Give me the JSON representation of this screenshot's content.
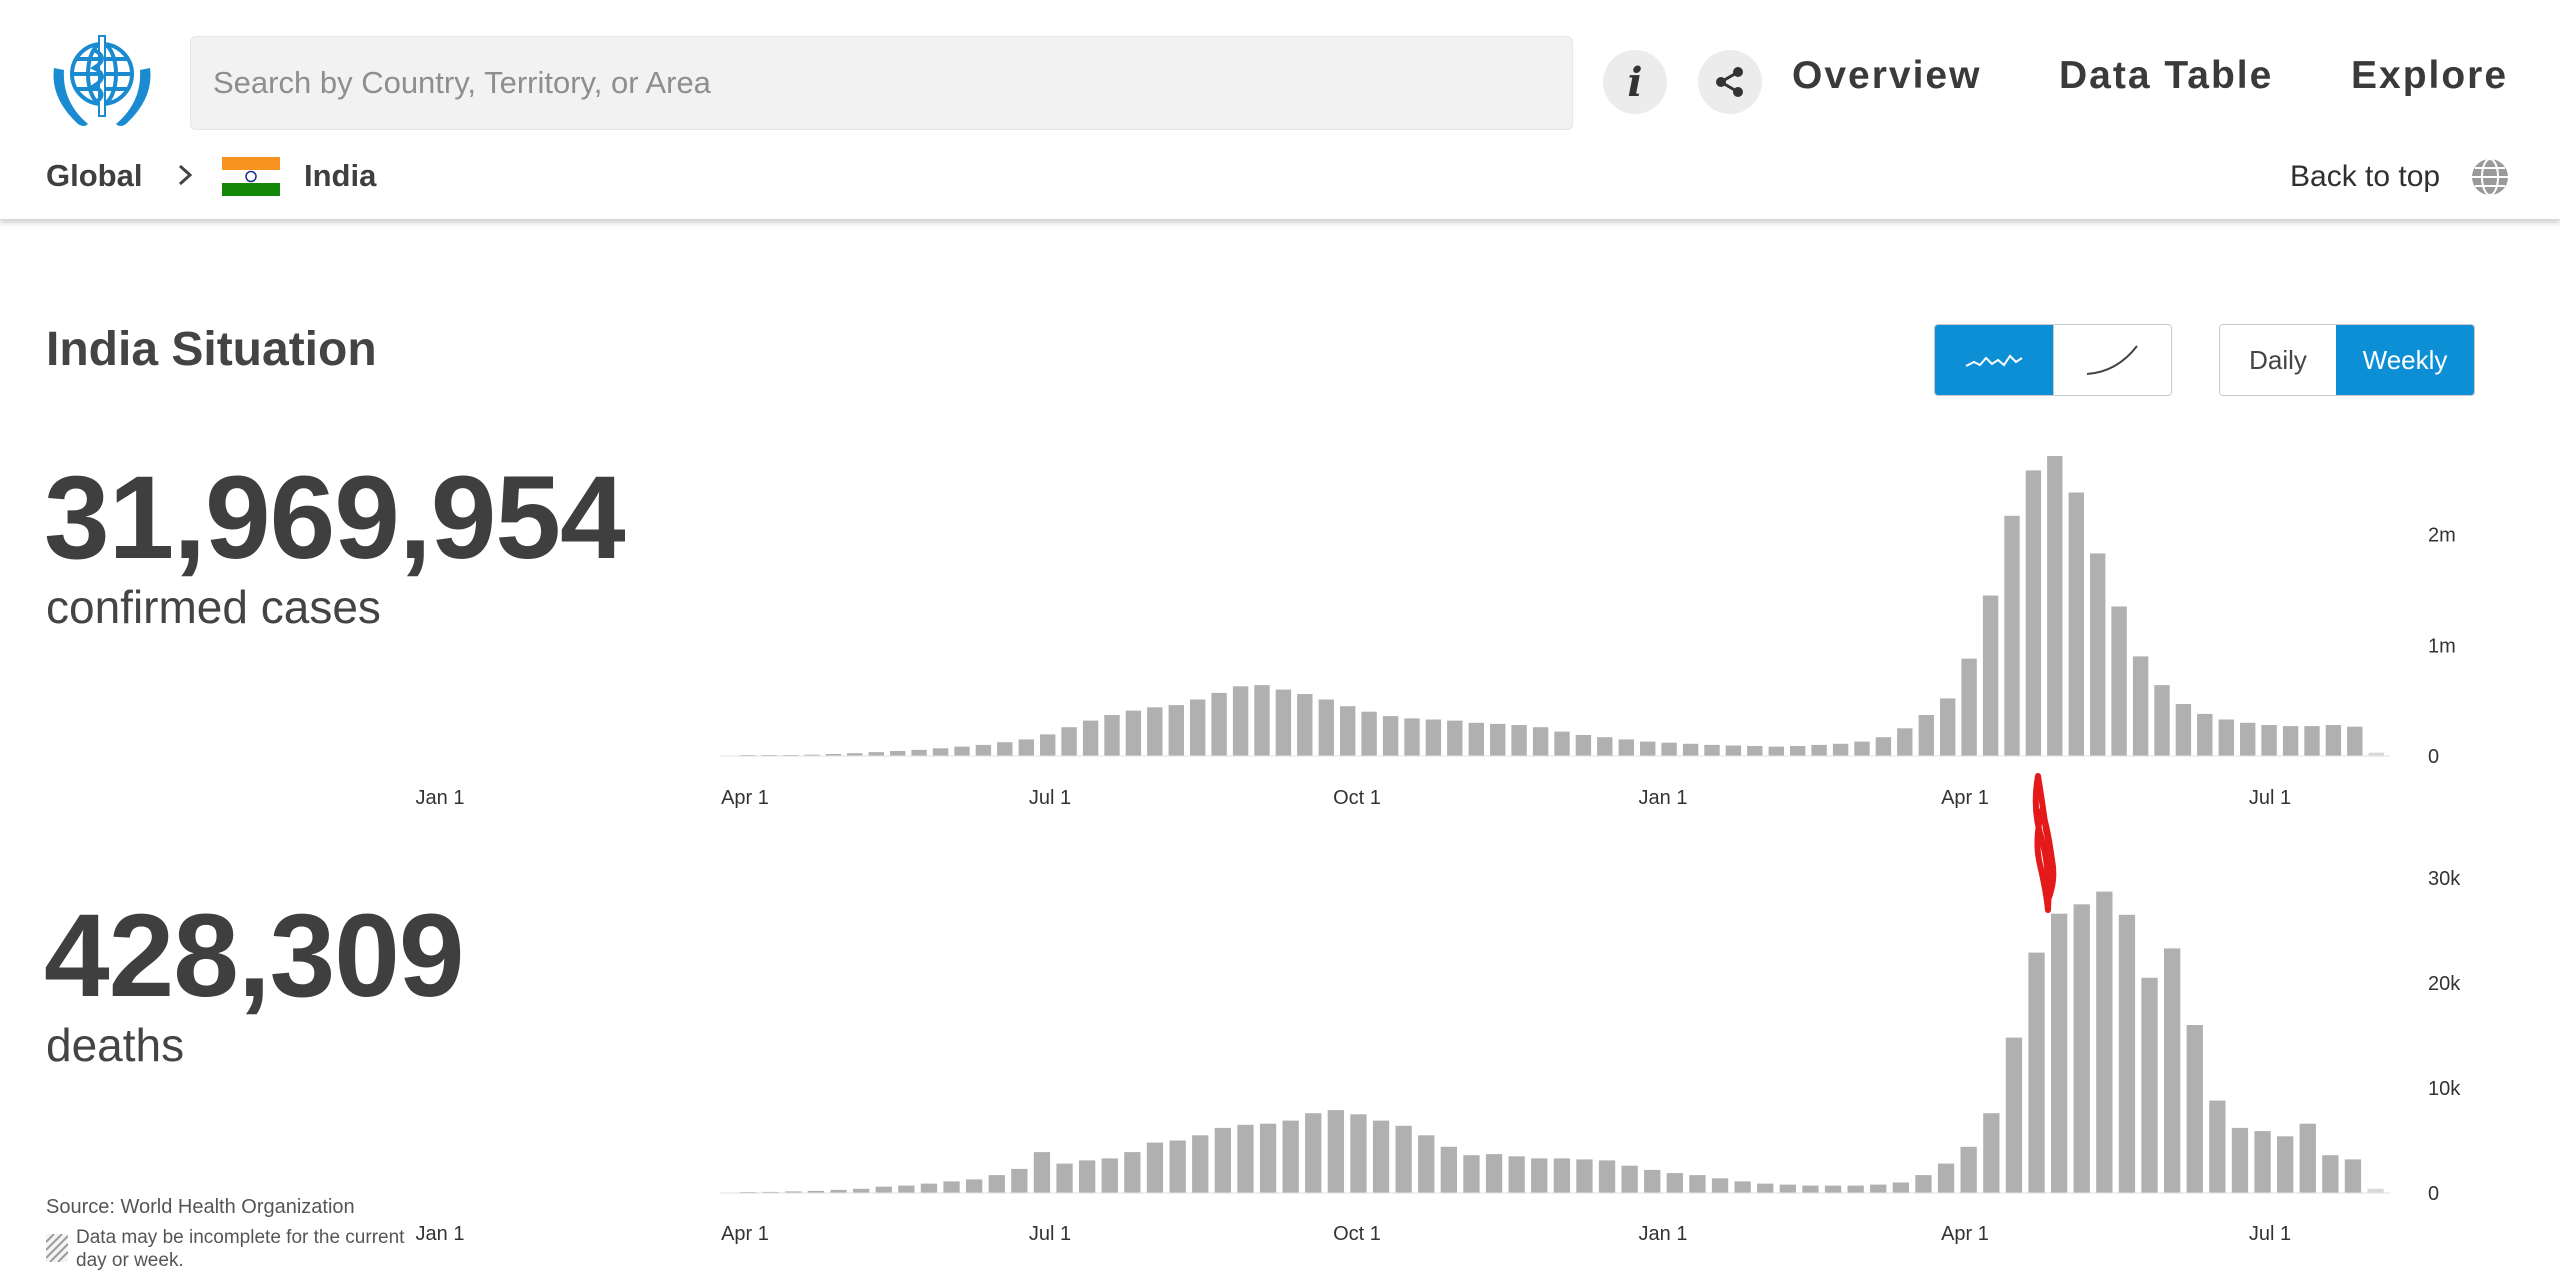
{
  "search": {
    "placeholder": "Search by Country, Territory, or Area"
  },
  "nav": {
    "overview": "Overview",
    "data_table": "Data Table",
    "explore": "Explore"
  },
  "icons": {
    "info": "i",
    "share": "share-icon",
    "logo": "who-emblem-icon",
    "globe": "globe-icon"
  },
  "breadcrumb": {
    "global": "Global",
    "country": "India"
  },
  "back_to_top": "Back to top",
  "page": {
    "title": "India Situation"
  },
  "controls": {
    "scale_options": [
      "linear-scale-icon",
      "cumulative-scale-icon"
    ],
    "scale_selected": "linear-scale-icon",
    "period_options": [
      "Daily",
      "Weekly"
    ],
    "period_selected": "Weekly"
  },
  "cases": {
    "value": "31,969,954",
    "label": "confirmed cases"
  },
  "deaths": {
    "value": "428,309",
    "label": "deaths"
  },
  "footer": {
    "source": "Source: World Health Organization",
    "note": "Data may be incomplete for the current day or week."
  },
  "colors": {
    "accent": "#0d8fd6",
    "bar": "#b0b0b0",
    "annotation": "#e41a1a"
  },
  "chart_data": [
    {
      "type": "bar",
      "name": "weekly-confirmed-cases",
      "title": "",
      "x_tick_labels": [
        "Jan 1",
        "Apr 1",
        "Jul 1",
        "Oct 1",
        "Jan 1",
        "Apr 1",
        "Jul 1"
      ],
      "y_tick_labels": [
        "0",
        "1m",
        "2m"
      ],
      "ylim": [
        0,
        2800000
      ],
      "last_bar_incomplete": true,
      "values": [
        2000,
        5000,
        8000,
        12000,
        18000,
        25000,
        35000,
        45000,
        55000,
        70000,
        85000,
        100000,
        125000,
        150000,
        195000,
        260000,
        320000,
        370000,
        410000,
        440000,
        460000,
        510000,
        570000,
        630000,
        640000,
        600000,
        560000,
        510000,
        450000,
        400000,
        360000,
        340000,
        330000,
        320000,
        300000,
        290000,
        280000,
        260000,
        220000,
        190000,
        170000,
        150000,
        130000,
        120000,
        110000,
        100000,
        95000,
        90000,
        85000,
        90000,
        100000,
        110000,
        130000,
        170000,
        250000,
        370000,
        520000,
        880000,
        1450000,
        2170000,
        2580000,
        2710000,
        2380000,
        1830000,
        1350000,
        900000,
        640000,
        470000,
        380000,
        330000,
        300000,
        280000,
        270000,
        270000,
        280000,
        265000,
        30000
      ]
    },
    {
      "type": "bar",
      "name": "weekly-deaths",
      "title": "",
      "x_tick_labels": [
        "Jan 1",
        "Apr 1",
        "Jul 1",
        "Oct 1",
        "Jan 1",
        "Apr 1",
        "Jul 1"
      ],
      "y_tick_labels": [
        "0",
        "10k",
        "20k",
        "30k"
      ],
      "ylim": [
        0,
        30000
      ],
      "last_bar_incomplete": true,
      "values": [
        50,
        100,
        150,
        200,
        300,
        400,
        600,
        700,
        900,
        1100,
        1300,
        1700,
        2300,
        3900,
        2800,
        3100,
        3300,
        3900,
        4800,
        5000,
        5500,
        6200,
        6500,
        6600,
        6900,
        7600,
        7900,
        7500,
        6900,
        6400,
        5500,
        4400,
        3600,
        3700,
        3500,
        3300,
        3300,
        3200,
        3100,
        2600,
        2200,
        1900,
        1700,
        1400,
        1100,
        900,
        800,
        700,
        700,
        700,
        800,
        1000,
        1700,
        2800,
        4400,
        7600,
        14800,
        22900,
        26600,
        27500,
        28700,
        26500,
        20500,
        23300,
        16000,
        8800,
        6200,
        5900,
        5400,
        6600,
        3600,
        3200,
        400
      ]
    }
  ]
}
